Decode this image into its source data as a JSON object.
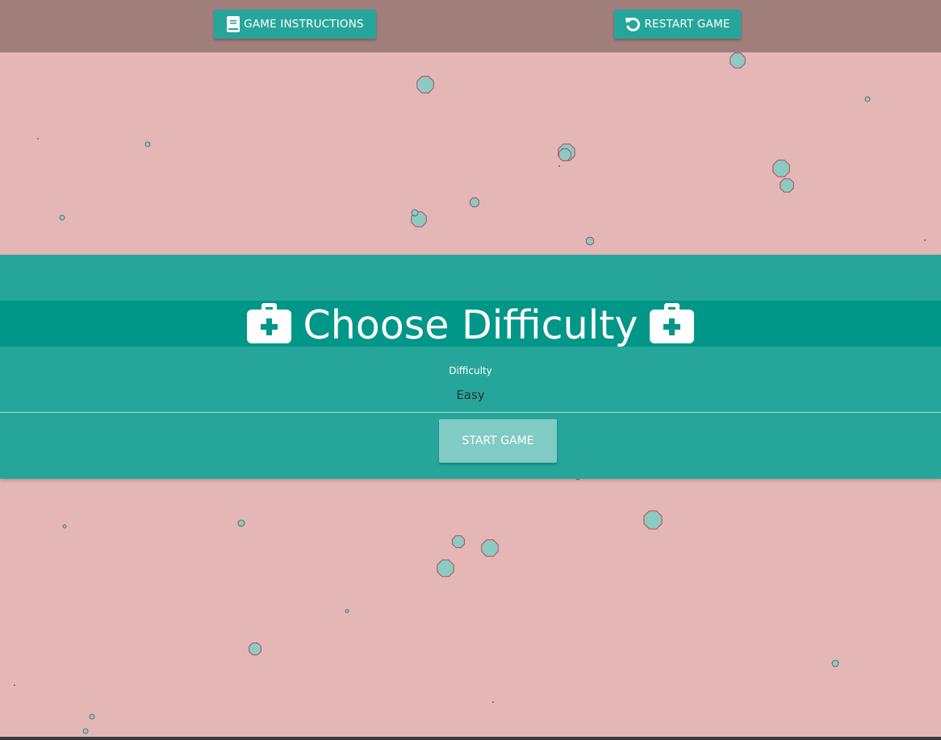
{
  "topbar": {
    "instructions_label": "GAME INSTRUCTIONS",
    "instructions_icon": "book-icon",
    "restart_label": "RESTART GAME",
    "restart_icon": "restart-icon"
  },
  "panel": {
    "title": "Choose Difficulty",
    "title_icon": "medkit-icon",
    "difficulty_label": "Difficulty",
    "difficulty_value": "Easy",
    "start_label": "START GAME"
  },
  "colors": {
    "background": "#e4b6b6",
    "topbar": "#a07e7c",
    "accent": "#26a69a",
    "accent_dark": "#009688",
    "start_button": "#80cbc4",
    "particle_fill": "#8ccbc1",
    "particle_stroke": "#b04a5e"
  }
}
